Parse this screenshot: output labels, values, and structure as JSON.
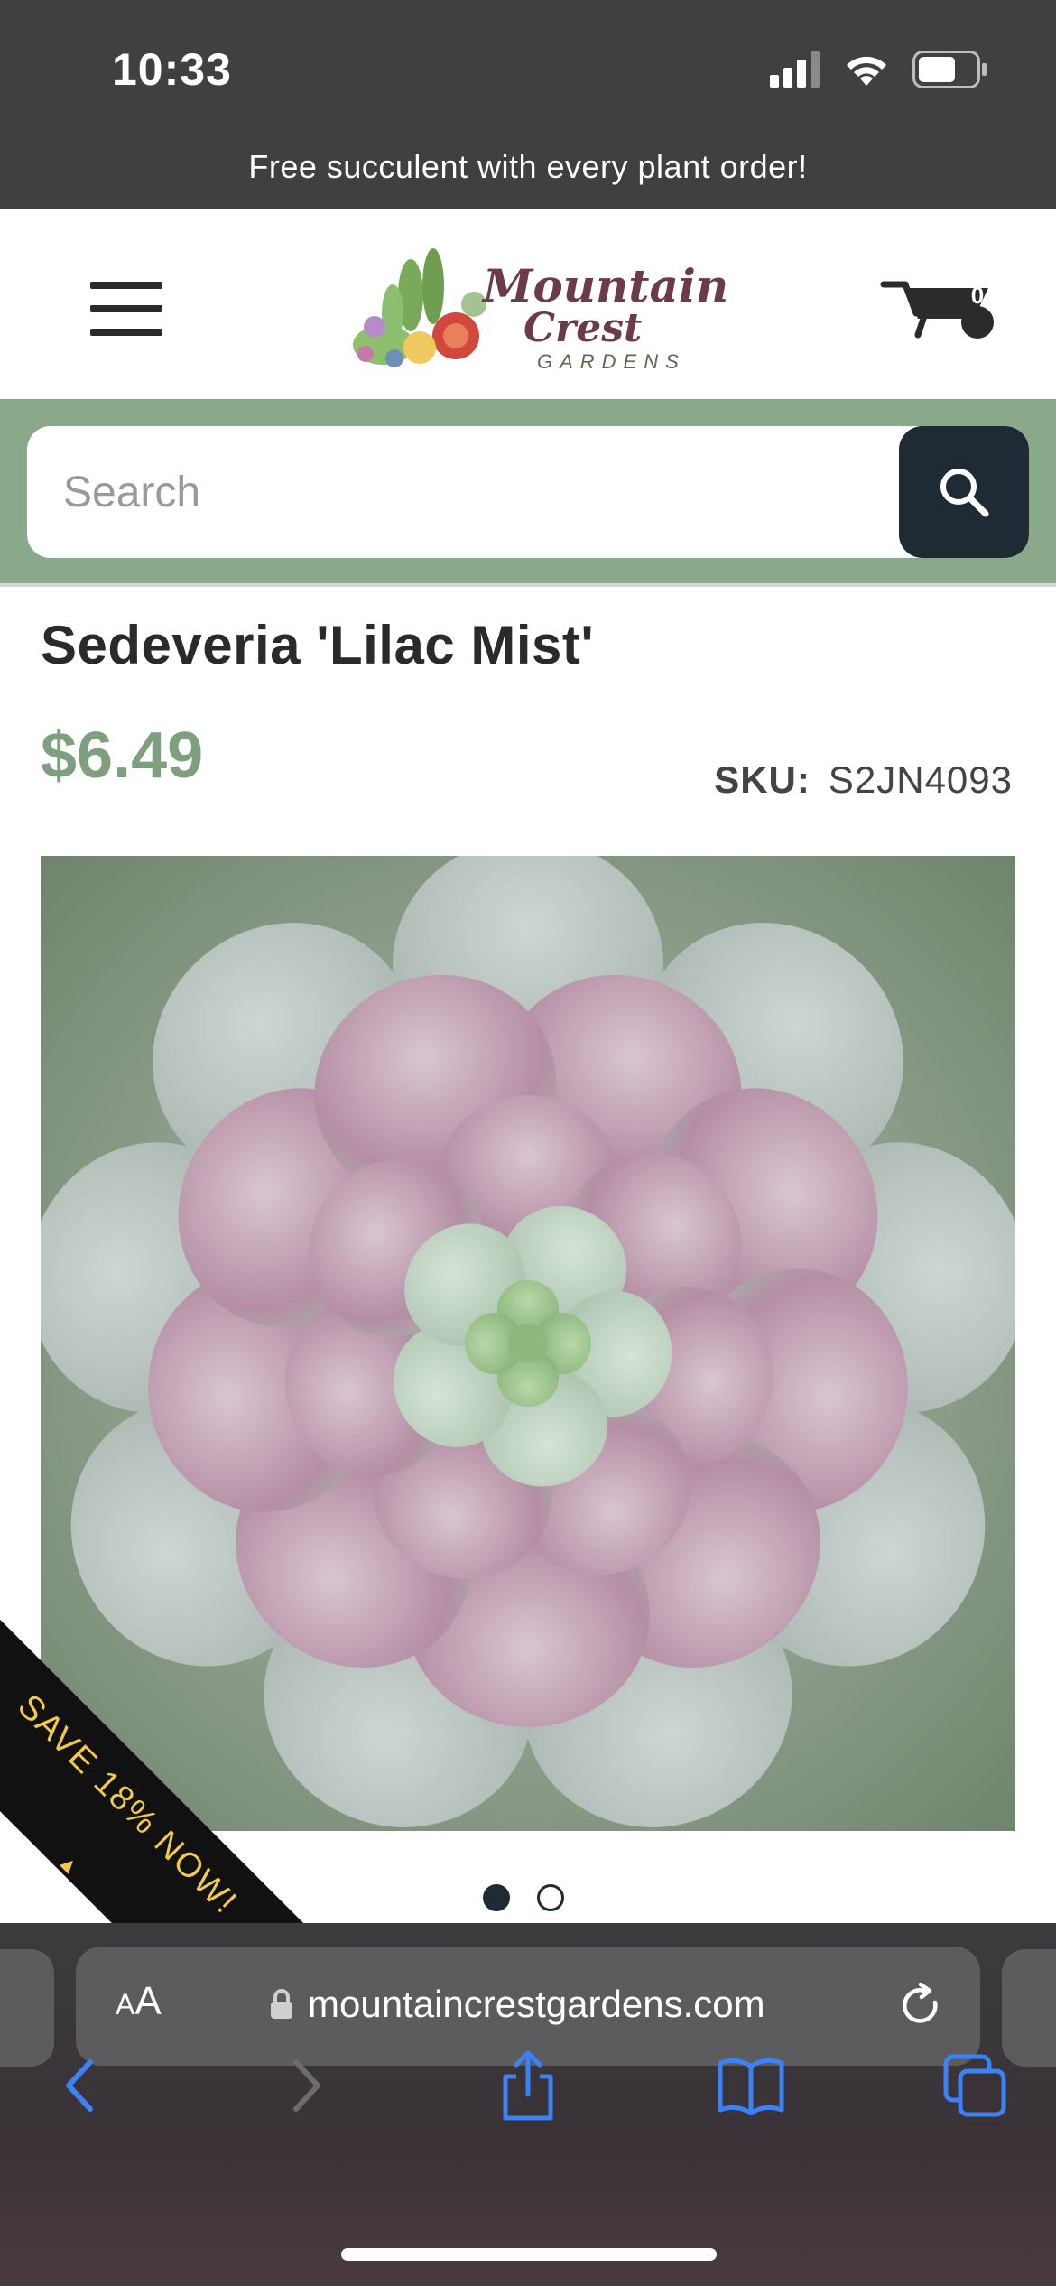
{
  "status_bar": {
    "time": "10:33",
    "battery_level": 0.65
  },
  "promo_banner": {
    "text": "Free succulent with every plant order!"
  },
  "header": {
    "logo": {
      "line1": "Mountain",
      "line2": "Crest",
      "line3": "GARDENS"
    },
    "cart_count": "0"
  },
  "search": {
    "placeholder": "Search"
  },
  "product": {
    "title": "Sedeveria 'Lilac Mist'",
    "price": "$6.49",
    "sku_label": "SKU:",
    "sku_value": "S2JN4093",
    "badge": "SAVE 18% NOW!",
    "carousel": {
      "count": 2,
      "active": 0
    }
  },
  "browser": {
    "aa_label_small": "A",
    "aa_label_large": "A",
    "url": "mountaincrestgardens.com"
  },
  "colors": {
    "accent_green": "#7fa07f",
    "search_band": "#8aa88a",
    "dark_navy": "#1e2b35",
    "ribbon_text": "#f2c94c",
    "ios_blue": "#3b82f6"
  }
}
